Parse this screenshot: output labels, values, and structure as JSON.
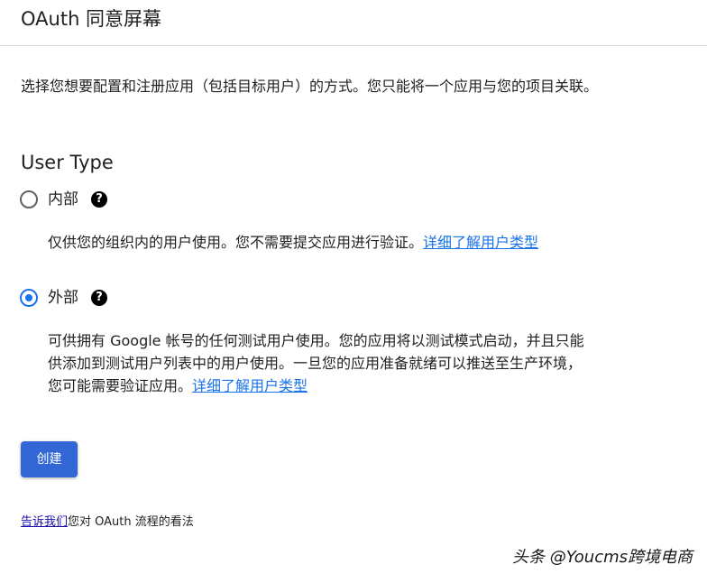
{
  "header": {
    "title": "OAuth 同意屏幕"
  },
  "intro": {
    "text": "选择您想要配置和注册应用（包括目标用户）的方式。您只能将一个应用与您的项目关联。"
  },
  "user_type": {
    "title": "User Type",
    "options": [
      {
        "label": "内部",
        "checked": false,
        "description": "仅供您的组织内的用户使用。您不需要提交应用进行验证。",
        "link": "详细了解用户类型"
      },
      {
        "label": "外部",
        "checked": true,
        "description": "可供拥有 Google 帐号的任何测试用户使用。您的应用将以测试模式启动，并且只能供添加到测试用户列表中的用户使用。一旦您的应用准备就绪可以推送至生产环境，您可能需要验证应用。",
        "link": "详细了解用户类型"
      }
    ],
    "help_icon": "help-circle-icon"
  },
  "actions": {
    "create_label": "创建"
  },
  "feedback": {
    "link": "告诉我们",
    "text": "您对 OAuth 流程的看法"
  },
  "watermark": {
    "text": "头条 @Youcms跨境电商"
  },
  "colors": {
    "accent": "#1a73e8",
    "button": "#3367d6"
  }
}
